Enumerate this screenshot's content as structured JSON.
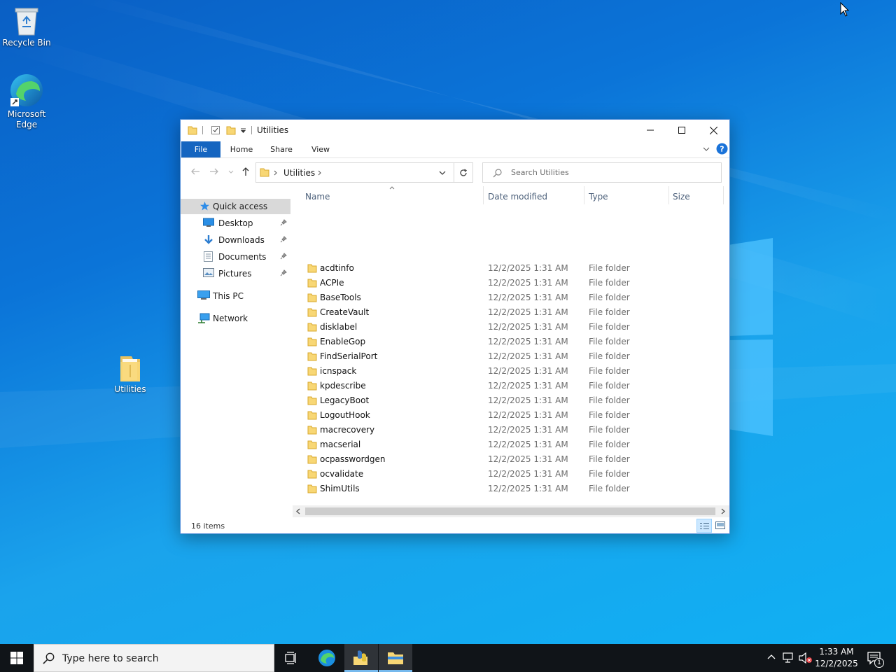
{
  "desktop": {
    "icons": [
      {
        "label": "Recycle Bin"
      },
      {
        "label": "Microsoft Edge"
      },
      {
        "label": "Utilities"
      }
    ]
  },
  "window": {
    "title": "Utilities",
    "ribbon_tabs": [
      "File",
      "Home",
      "Share",
      "View"
    ],
    "address": {
      "segment": "Utilities"
    },
    "search_placeholder": "Search Utilities",
    "nav": {
      "quick_access": "Quick access",
      "desktop": "Desktop",
      "downloads": "Downloads",
      "documents": "Documents",
      "pictures": "Pictures",
      "this_pc": "This PC",
      "network": "Network"
    },
    "columns": {
      "name": "Name",
      "date": "Date modified",
      "type": "Type",
      "size": "Size"
    },
    "files": [
      {
        "name": "acdtinfo",
        "date": "12/2/2025 1:31 AM",
        "type": "File folder"
      },
      {
        "name": "ACPIe",
        "date": "12/2/2025 1:31 AM",
        "type": "File folder"
      },
      {
        "name": "BaseTools",
        "date": "12/2/2025 1:31 AM",
        "type": "File folder"
      },
      {
        "name": "CreateVault",
        "date": "12/2/2025 1:31 AM",
        "type": "File folder"
      },
      {
        "name": "disklabel",
        "date": "12/2/2025 1:31 AM",
        "type": "File folder"
      },
      {
        "name": "EnableGop",
        "date": "12/2/2025 1:31 AM",
        "type": "File folder"
      },
      {
        "name": "FindSerialPort",
        "date": "12/2/2025 1:31 AM",
        "type": "File folder"
      },
      {
        "name": "icnspack",
        "date": "12/2/2025 1:31 AM",
        "type": "File folder"
      },
      {
        "name": "kpdescribe",
        "date": "12/2/2025 1:31 AM",
        "type": "File folder"
      },
      {
        "name": "LegacyBoot",
        "date": "12/2/2025 1:31 AM",
        "type": "File folder"
      },
      {
        "name": "LogoutHook",
        "date": "12/2/2025 1:31 AM",
        "type": "File folder"
      },
      {
        "name": "macrecovery",
        "date": "12/2/2025 1:31 AM",
        "type": "File folder"
      },
      {
        "name": "macserial",
        "date": "12/2/2025 1:31 AM",
        "type": "File folder"
      },
      {
        "name": "ocpasswordgen",
        "date": "12/2/2025 1:31 AM",
        "type": "File folder"
      },
      {
        "name": "ocvalidate",
        "date": "12/2/2025 1:31 AM",
        "type": "File folder"
      },
      {
        "name": "ShimUtils",
        "date": "12/2/2025 1:31 AM",
        "type": "File folder"
      }
    ],
    "status": "16 items"
  },
  "taskbar": {
    "search_placeholder": "Type here to search",
    "time": "1:33 AM",
    "date": "12/2/2025",
    "notification_count": "1"
  },
  "colors": {
    "accent": "#1565c0",
    "selection": "#d9d9d9",
    "taskbar": "#101418",
    "folder": "#f8d775"
  },
  "icons": [
    "recycle-bin-icon",
    "edge-icon",
    "folder-icon",
    "star-icon",
    "desktop-icon",
    "download-icon",
    "documents-icon",
    "pictures-icon",
    "computer-icon",
    "network-icon",
    "pin-icon",
    "windows-start-icon",
    "search-icon",
    "task-view-icon",
    "file-explorer-icon",
    "notification-icon"
  ]
}
